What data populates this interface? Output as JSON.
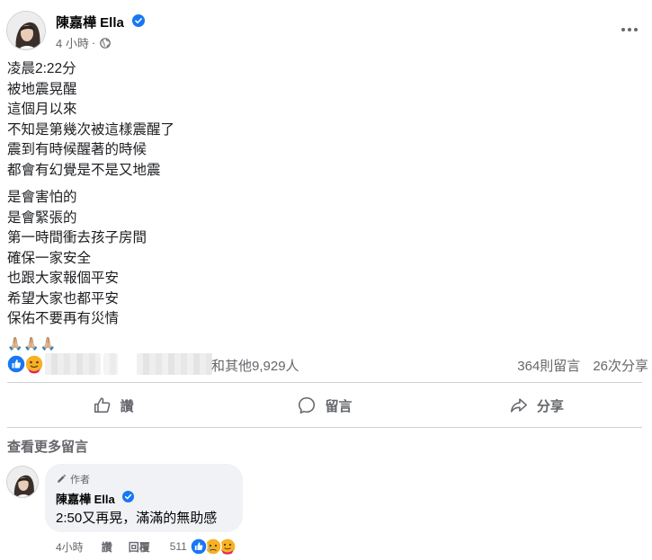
{
  "post": {
    "author": "陳嘉樺 Ella",
    "time": "4 小時",
    "dot": "·",
    "paragraphs": [
      [
        "凌晨2:22分",
        "被地震晃醒",
        "這個月以來",
        "不知是第幾次被這樣震醒了",
        "震到有時候醒著的時候",
        "都會有幻覺是不是又地震"
      ],
      [
        "是會害怕的",
        "是會緊張的",
        "第一時間衝去孩子房間",
        "確保一家安全",
        "也跟大家報個平安",
        "希望大家也都平安",
        "保佑不要再有災情"
      ]
    ],
    "emojis": "🙏🏼🙏🏼🙏🏼"
  },
  "reactions": {
    "icons": [
      "like-icon",
      "care-icon"
    ],
    "others_text": "和其他9,929人",
    "comments_count": "364則留言",
    "shares_count": "26次分享"
  },
  "actions": {
    "like": "讚",
    "comment": "留言",
    "share": "分享"
  },
  "view_more_comments": "查看更多留言",
  "comment": {
    "badge": "作者",
    "author": "陳嘉樺 Ella",
    "text": "2:50又再晃，滿滿的無助感",
    "time": "4小時",
    "like": "讚",
    "reply": "回覆",
    "reaction_count": "511",
    "reaction_icons": [
      "like-icon",
      "sad-icon",
      "care-icon"
    ]
  },
  "colors": {
    "facebook_blue": "#1877f2",
    "secondary_text": "#65676b",
    "bubble_bg": "#f0f2f5"
  }
}
